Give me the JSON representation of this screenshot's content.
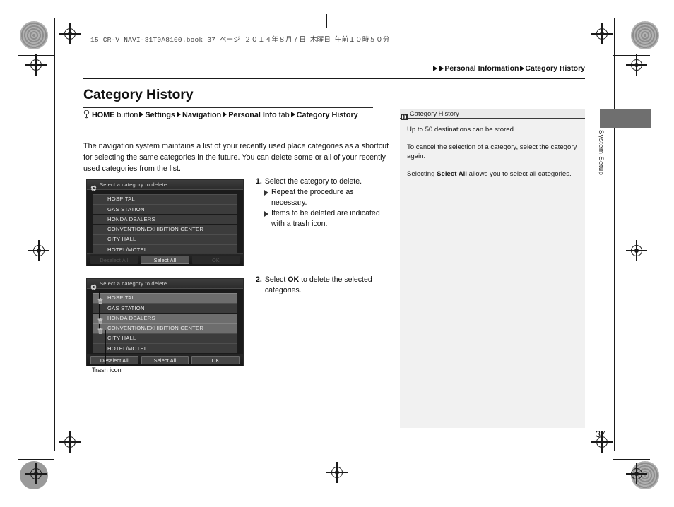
{
  "print_header": {
    "book_line": "15 CR-V NAVI-31T0A8100.book   37 ページ   ２０１４年８月７日   木曜日   午前１０時５０分"
  },
  "breadcrumb": {
    "items": [
      "Personal Information",
      "Category History"
    ]
  },
  "page_title": "Category History",
  "nav_path": {
    "prefix_button": "HOME",
    "prefix_suffix": " button",
    "steps": [
      "Settings",
      "Navigation"
    ],
    "personal_info": "Personal Info",
    "personal_info_suffix": " tab",
    "final": "Category History"
  },
  "intro": "The navigation system maintains a list of your recently used place categories as a shortcut for selecting the same categories in the future. You can delete some or all of your recently used categories from the list.",
  "screenshot_1": {
    "title": "Select a category to delete",
    "rows": [
      {
        "label": "HOSPITAL",
        "selected": false,
        "trash": false
      },
      {
        "label": "GAS STATION",
        "selected": false,
        "trash": false
      },
      {
        "label": "HONDA DEALERS",
        "selected": false,
        "trash": false
      },
      {
        "label": "CONVENTION/EXHIBITION CENTER",
        "selected": false,
        "trash": false
      },
      {
        "label": "CITY HALL",
        "selected": false,
        "trash": false
      },
      {
        "label": "HOTEL/MOTEL",
        "selected": false,
        "trash": false
      }
    ],
    "buttons": {
      "deselect_all": "Deselect All",
      "select_all": "Select All",
      "ok": "OK"
    }
  },
  "screenshot_2": {
    "title": "Select a category to delete",
    "rows": [
      {
        "label": "HOSPITAL",
        "selected": true,
        "trash": true
      },
      {
        "label": "GAS STATION",
        "selected": false,
        "trash": false
      },
      {
        "label": "HONDA DEALERS",
        "selected": true,
        "trash": true
      },
      {
        "label": "CONVENTION/EXHIBITION CENTER",
        "selected": true,
        "trash": true
      },
      {
        "label": "CITY HALL",
        "selected": false,
        "trash": false
      },
      {
        "label": "HOTEL/MOTEL",
        "selected": false,
        "trash": false
      }
    ],
    "buttons": {
      "deselect_all": "Deselect All",
      "select_all": "Select All",
      "ok": "OK"
    }
  },
  "callout": {
    "trash_icon_caption": "Trash icon"
  },
  "steps": {
    "step1": {
      "num": "1.",
      "text": "Select the category to delete.",
      "sub": [
        "Repeat the procedure as necessary.",
        "Items to be deleted are indicated with a trash icon."
      ]
    },
    "step2": {
      "num": "2.",
      "text_before": "Select ",
      "bold": "OK",
      "text_after": " to delete the selected categories."
    }
  },
  "info_panel": {
    "heading": "Category History",
    "para1": "Up to 50 destinations can be stored.",
    "para2": "To cancel the selection of a category, select the category again.",
    "para3_before": "Selecting ",
    "para3_bold": "Select All",
    "para3_after": " allows you to select all categories."
  },
  "thumb_tab": {
    "label": "System Setup"
  },
  "folio": "37",
  "colors": {
    "page_bg": "#ffffff",
    "ink": "#111111",
    "panel_bg": "#f1f1f1",
    "tab_gray": "#6f6f6f",
    "screen_bg": "#1b1b1b",
    "row_bg": "#3c3c3c",
    "row_selected": "#6d6d6d"
  }
}
